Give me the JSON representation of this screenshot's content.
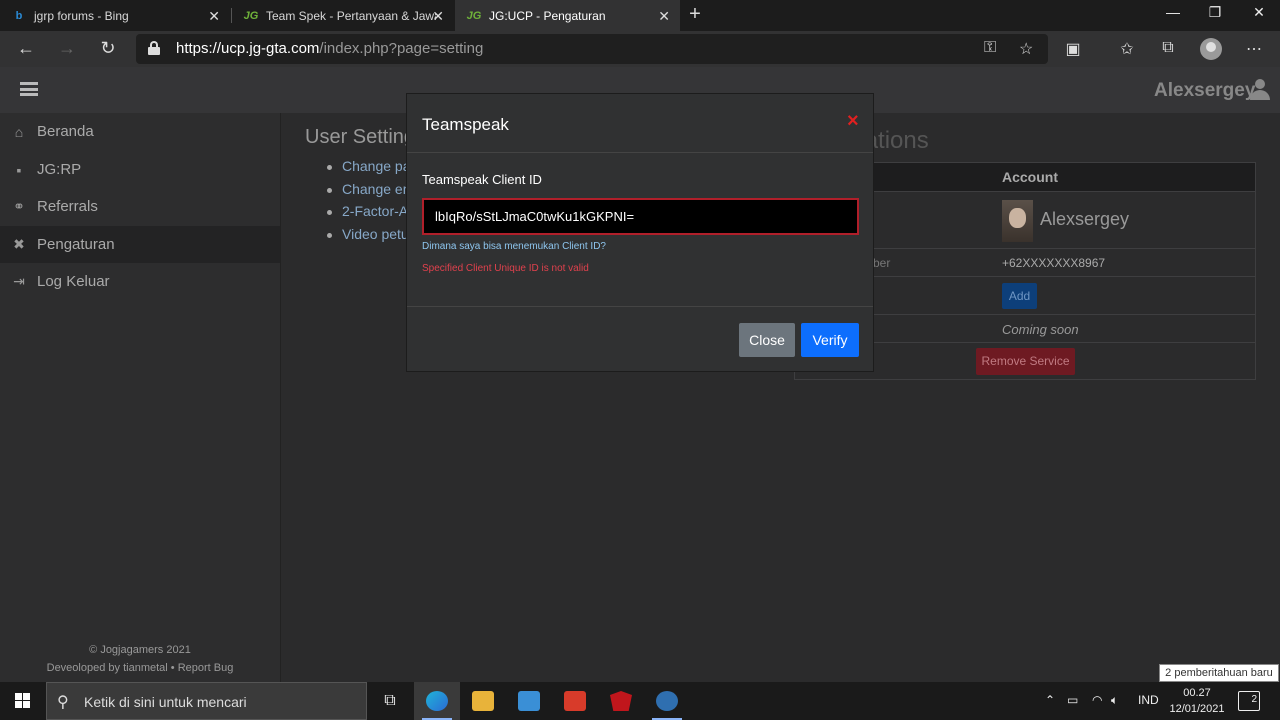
{
  "browser": {
    "tabs": [
      {
        "label": "jgrp forums - Bing",
        "icon": "bing-icon"
      },
      {
        "label": "Team Spek - Pertanyaan & Jawab",
        "icon": "jg-icon"
      },
      {
        "label": "JG:UCP - Pengaturan",
        "icon": "jg-icon"
      }
    ],
    "url_host": "https://ucp.jg-gta.com",
    "url_path": "/index.php?page=setting"
  },
  "header": {
    "username": "Alexsergey"
  },
  "sidebar": {
    "items": [
      {
        "label": "Beranda",
        "icon": "home-icon"
      },
      {
        "label": "JG:RP",
        "icon": "jgrp-icon"
      },
      {
        "label": "Referrals",
        "icon": "handshake-icon"
      },
      {
        "label": "Pengaturan",
        "icon": "wrench-icon"
      },
      {
        "label": "Log Keluar",
        "icon": "logout-icon"
      }
    ],
    "footer_copy": "© Jogjagamers 2021",
    "footer_dev_prefix": "Deveoloped by",
    "footer_dev_name": "tianmetal",
    "footer_sep": "•",
    "footer_report": "Report Bug"
  },
  "user_settings": {
    "title": "User Settings",
    "links": [
      "Change pa",
      "Change em",
      "2-Factor-A",
      "Video petu"
    ]
  },
  "associations": {
    "title": "Associations",
    "column_header": "Account",
    "account_name": "Alexsergey",
    "phone_label_partial": "ber",
    "phone": "+62XXXXXXX8967",
    "add_label": "Add",
    "coming_soon": "Coming soon",
    "remove_label": "Remove Service"
  },
  "modal": {
    "title": "Teamspeak",
    "close_icon": "×",
    "field_label": "Teamspeak Client ID",
    "field_value": "lbIqRo/sStLJmaC0twKu1kGKPNI=",
    "help_link": "Dimana saya bisa menemukan Client ID?",
    "error": "Specified Client Unique ID is not valid",
    "close_button": "Close",
    "verify_button": "Verify"
  },
  "taskbar": {
    "search_placeholder": "Ketik di sini untuk mencari",
    "language": "IND",
    "time": "00.27",
    "date": "12/01/2021",
    "notif_count": "2",
    "notif_toast": "2 pemberitahuan baru"
  },
  "colors": {
    "accent_blue": "#0d6efd",
    "error_red": "#e0414d",
    "close_red": "#e02020"
  }
}
